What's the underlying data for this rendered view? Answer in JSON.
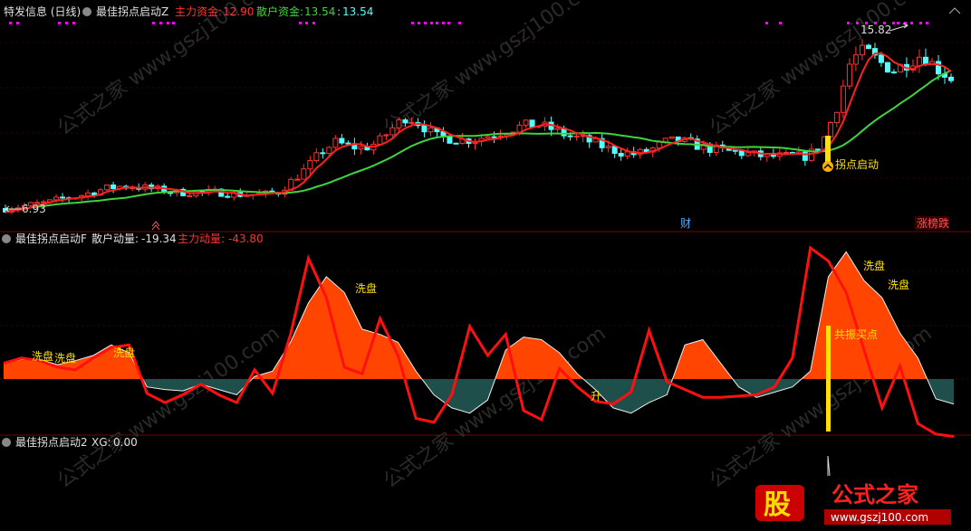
{
  "panels": {
    "main": {
      "title": "特发信息 (日线)",
      "indicator": "最佳拐点启动Z",
      "main_fund_label": "主力资金:",
      "main_fund_value": "12.90",
      "retail_fund_label": "散户资金:",
      "retail_fund_value": "13.54",
      "retail_fund_value2": "13.54",
      "high_label": "15.82",
      "low_label": "6.93",
      "signal_label": "拐点启动",
      "marker_cai": "财",
      "marker_board": "涨榜跌"
    },
    "sub1": {
      "indicator": "最佳拐点启动F",
      "retail_label": "散户动量:",
      "retail_value": "-19.34",
      "main_label": "主力动量:",
      "main_value": "-43.80",
      "annotations": [
        "洗盘",
        "洗盘",
        "洗盘",
        "洗盘",
        "洗盘",
        "洗盘",
        "升",
        "共振买点"
      ]
    },
    "sub2": {
      "indicator": "最佳拐点启动2",
      "xg_label": "XG:",
      "xg_value": "0.00"
    }
  },
  "watermark": {
    "text": "公式之家",
    "url": "www.gszj100.com",
    "logo_char": "股"
  },
  "colors": {
    "up": "#ff3232",
    "down": "#54ffff",
    "ma_red": "#ff2020",
    "ma_green": "#3ed43e",
    "fill_red": "#ff4500",
    "fill_teal": "#1f4f4a",
    "signal": "#ffe000",
    "magenta": "#ff00ff"
  },
  "chart_data": [
    {
      "type": "candlestick",
      "price_high": 15.82,
      "price_low": 6.93,
      "close_path": [
        7.0,
        7.1,
        7.2,
        7.3,
        7.5,
        7.6,
        7.8,
        8.0,
        8.1,
        8.1,
        8.0,
        7.9,
        7.8,
        7.8,
        7.8,
        7.8,
        7.7,
        7.7,
        7.7,
        7.8,
        8.4,
        9.0,
        9.8,
        10.3,
        10.1,
        10.0,
        10.3,
        11.0,
        11.6,
        11.2,
        10.6,
        10.5,
        10.4,
        10.5,
        10.7,
        10.9,
        11.1,
        11.2,
        11.0,
        10.7,
        10.5,
        10.3,
        10.0,
        9.8,
        9.7,
        9.9,
        10.3,
        10.4,
        10.2,
        10.0,
        9.9,
        9.8,
        9.7,
        9.6,
        9.6,
        9.6,
        9.6,
        10.3,
        12.0,
        14.4,
        14.9,
        14.3,
        13.9,
        14.3,
        14.7,
        14.0,
        13.5
      ]
    },
    {
      "type": "area",
      "series": [
        {
          "name": "散户动量",
          "values": [
            12,
            15,
            15,
            11,
            14,
            18,
            26,
            20,
            -6,
            -8,
            -9,
            -4,
            -8,
            -12,
            2,
            6,
            28,
            58,
            78,
            66,
            38,
            34,
            28,
            6,
            -12,
            -22,
            -26,
            -16,
            22,
            32,
            30,
            20,
            4,
            -8,
            -22,
            -26,
            -18,
            -12,
            26,
            30,
            12,
            -6,
            -14,
            -10,
            -6,
            6,
            78,
            97,
            75,
            62,
            35,
            16,
            -15,
            -19
          ]
        },
        {
          "name": "主力动量",
          "values": [
            12,
            16,
            14,
            9,
            7,
            16,
            24,
            26,
            -11,
            -18,
            -12,
            -4,
            -12,
            -18,
            7,
            -11,
            34,
            92,
            62,
            9,
            4,
            46,
            18,
            -30,
            -33,
            -12,
            40,
            18,
            34,
            -24,
            -31,
            8,
            -6,
            -17,
            -19,
            -10,
            37,
            -2,
            -8,
            -14,
            -14,
            -13,
            -12,
            -6,
            16,
            100,
            90,
            66,
            22,
            -22,
            10,
            -34,
            -42,
            -43.8
          ]
        }
      ]
    },
    {
      "type": "line",
      "series": [
        {
          "name": "XG",
          "values": [
            0,
            0,
            1,
            0,
            0
          ]
        }
      ]
    }
  ]
}
